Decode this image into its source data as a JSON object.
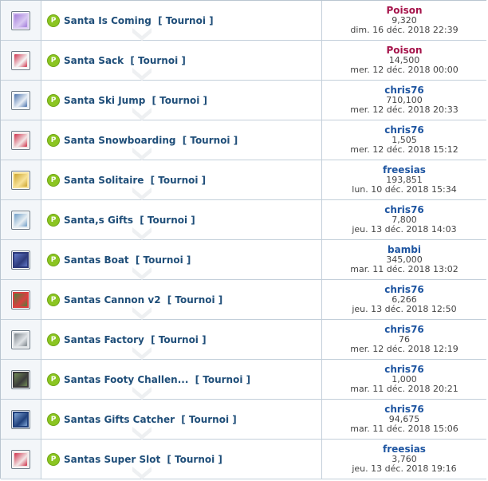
{
  "link_suffix": "[ Tournoi ]",
  "colors": {
    "badge": "#8bc521",
    "link": "#1f4e79",
    "player_default": "#1e55a1",
    "player_poison": "#a5134a",
    "border": "#c3cfda"
  },
  "rows": [
    {
      "icon": "santa-coming-thumbnail-icon",
      "game": "Santa Is Coming",
      "player": "Poison",
      "score": "9,320",
      "date": "dim. 16 déc. 2018 22:39"
    },
    {
      "icon": "santa-sack-thumbnail-icon",
      "game": "Santa Sack",
      "player": "Poison",
      "score": "14,500",
      "date": "mer. 12 déc. 2018 00:00"
    },
    {
      "icon": "ski-jump-thumbnail-icon",
      "game": "Santa Ski Jump",
      "player": "chris76",
      "score": "710,100",
      "date": "mer. 12 déc. 2018 20:33"
    },
    {
      "icon": "snowboarding-thumbnail-icon",
      "game": "Santa Snowboarding",
      "player": "chris76",
      "score": "1,505",
      "date": "mer. 12 déc. 2018 15:12"
    },
    {
      "icon": "solitaire-thumbnail-icon",
      "game": "Santa Solitaire",
      "player": "freesias",
      "score": "193,851",
      "date": "lun. 10 déc. 2018 15:34"
    },
    {
      "icon": "gifts-thumbnail-icon",
      "game": "Santa,s Gifts",
      "player": "chris76",
      "score": "7,800",
      "date": "jeu. 13 déc. 2018 14:03"
    },
    {
      "icon": "boat-thumbnail-icon",
      "game": "Santas Boat",
      "player": "bambi",
      "score": "345,000",
      "date": "mar. 11 déc. 2018 13:02"
    },
    {
      "icon": "cannon-thumbnail-icon",
      "game": "Santas Cannon v2",
      "player": "chris76",
      "score": "6,266",
      "date": "jeu. 13 déc. 2018 12:50"
    },
    {
      "icon": "factory-thumbnail-icon",
      "game": "Santas Factory",
      "player": "chris76",
      "score": "76",
      "date": "mer. 12 déc. 2018 12:19"
    },
    {
      "icon": "footy-thumbnail-icon",
      "game": "Santas Footy Challen...",
      "player": "chris76",
      "score": "1,000",
      "date": "mar. 11 déc. 2018 20:21"
    },
    {
      "icon": "gifts-catcher-thumbnail-icon",
      "game": "Santas Gifts Catcher",
      "player": "chris76",
      "score": "94,675",
      "date": "mar. 11 déc. 2018 15:06"
    },
    {
      "icon": "super-slot-thumbnail-icon",
      "game": "Santas Super Slot",
      "player": "freesias",
      "score": "3,760",
      "date": "jeu. 13 déc. 2018 19:16"
    }
  ]
}
